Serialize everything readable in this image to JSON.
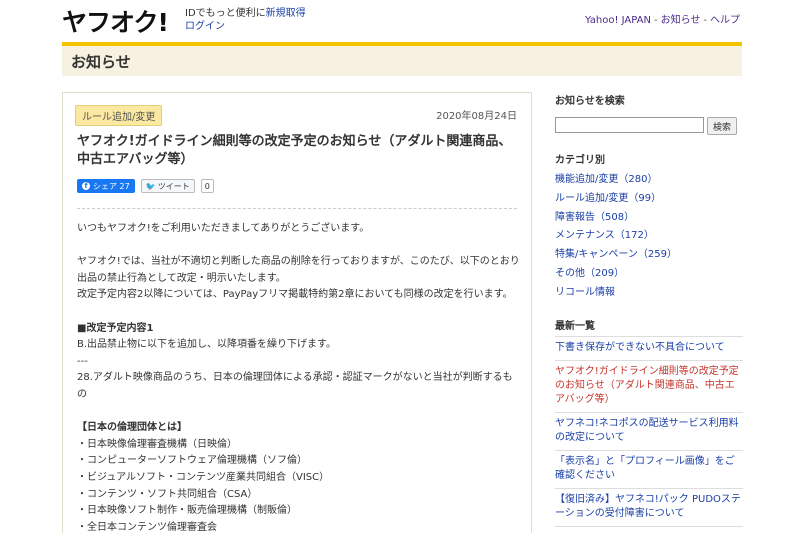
{
  "header": {
    "logo": "ヤフオク!",
    "id_note": "IDでもっと便利に",
    "register_link": "新規取得",
    "login_link": "ログイン",
    "top_links": [
      "Yahoo! JAPAN",
      "お知らせ",
      "ヘルプ"
    ],
    "top_sep": "-"
  },
  "page_title": "お知らせ",
  "article": {
    "tag": "ルール追加/変更",
    "date": "2020年08月24日",
    "title": "ヤフオク!ガイドライン細則等の改定予定のお知らせ（アダルト関連商品、中古エアバッグ等）",
    "share": {
      "fb_label": "シェア 27",
      "tw_label": "ツイート",
      "tw_count": "0"
    },
    "lines": [
      "いつもヤフオク!をご利用いただきましてありがとうございます。",
      "",
      "ヤフオク!では、当社が不適切と判断した商品の削除を行っておりますが、このたび、以下のとおり出品の禁止行為として改定・明示いたします。",
      "改定予定内容2以降については、PayPayフリマ掲載特約第2章においても同様の改定を行います。",
      "",
      "■改定予定内容1",
      "B.出品禁止物に以下を追加し、以降項番を繰り下げます。",
      "---",
      "28.アダルト映像商品のうち、日本の倫理団体による承認・認証マークがないと当社が判断するもの",
      "",
      "【日本の倫理団体とは】",
      "・日本映像倫理審査機構（日映倫）",
      "・コンピューターソフトウェア倫理機構（ソフ倫）",
      "・ビジュアルソフト・コンテンツ産業共同組合（VISC）",
      "・コンテンツ・ソフト共同組合（CSA）",
      "・日本映像ソフト制作・販売倫理機構（制販倫）",
      "・全日本コンテンツ倫理審査会"
    ]
  },
  "sidebar": {
    "search_heading": "お知らせを検索",
    "search_button": "検索",
    "search_value": "",
    "category_heading": "カテゴリ別",
    "categories": [
      "機能追加/変更（280）",
      "ルール追加/変更（99）",
      "障害報告（508）",
      "メンテナンス（172）",
      "特集/キャンペーン（259）",
      "その他（209）",
      "リコール情報"
    ],
    "news_heading": "最新一覧",
    "news": [
      "下書き保存ができない不具合について",
      "ヤフオク!ガイドライン細則等の改定予定のお知らせ（アダルト関連商品、中古エアバッグ等）",
      "ヤフネコ!ネコポスの配送サービス利用料の改定について",
      "「表示名」と「プロフィール画像」をご確認ください",
      "【復旧済み】ヤフネコ!パック PUDOステーションの受付障害について"
    ]
  },
  "colors": {
    "accent_yellow": "#f5c400",
    "link_blue": "#1a3fa6",
    "highlight_red": "#c7342b",
    "facebook_blue": "#1877f2"
  }
}
